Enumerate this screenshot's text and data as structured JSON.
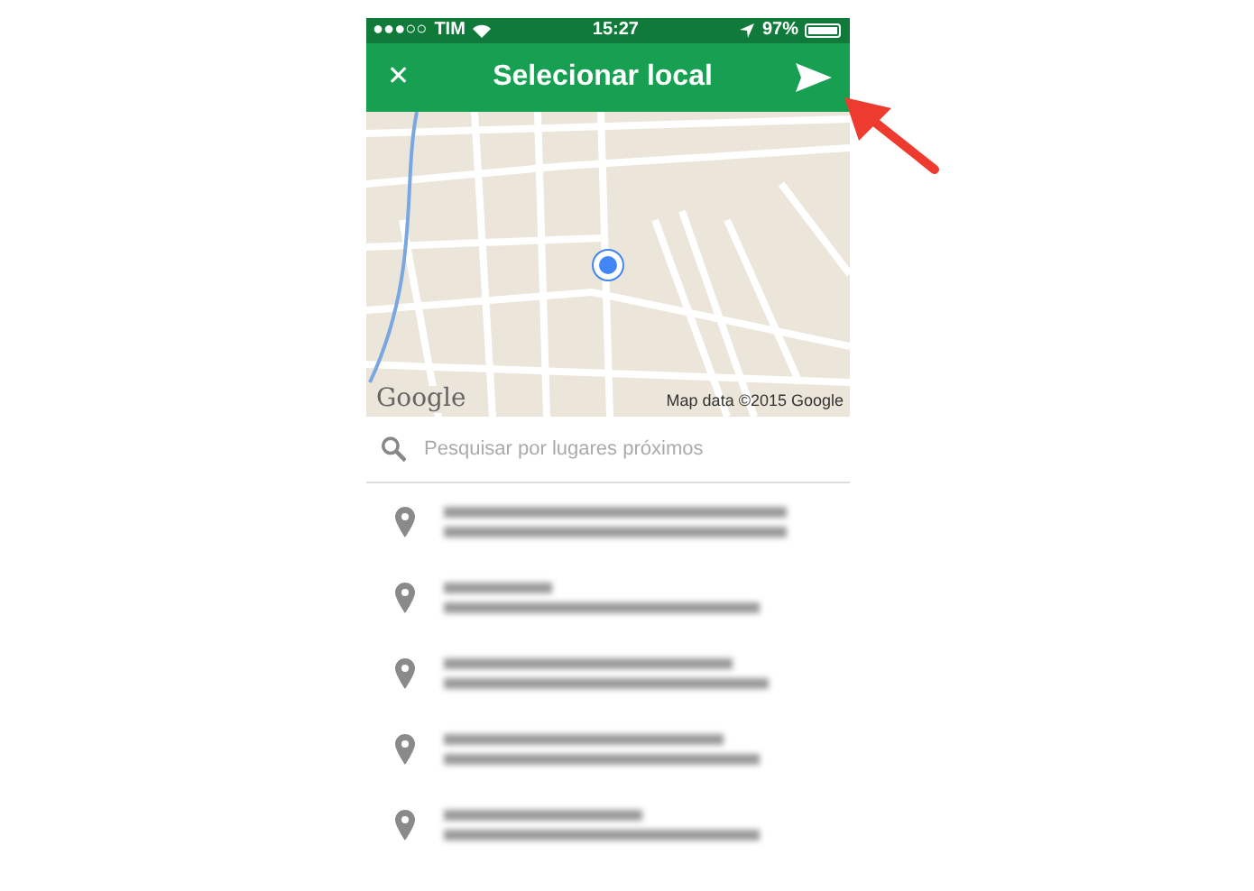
{
  "status_bar": {
    "carrier": "TIM",
    "signal_dots": "●●●○○",
    "time": "15:27",
    "battery": "97%"
  },
  "header": {
    "title": "Selecionar local",
    "close_glyph": "✕"
  },
  "map": {
    "logo": "Google",
    "attribution": "Map data ©2015 Google"
  },
  "search": {
    "placeholder": "Pesquisar por lugares próximos"
  },
  "places": [
    {
      "blurred": true
    },
    {
      "blurred": true
    },
    {
      "blurred": true
    },
    {
      "blurred": true
    },
    {
      "blurred": true
    }
  ],
  "annotation": {
    "arrow": true
  }
}
